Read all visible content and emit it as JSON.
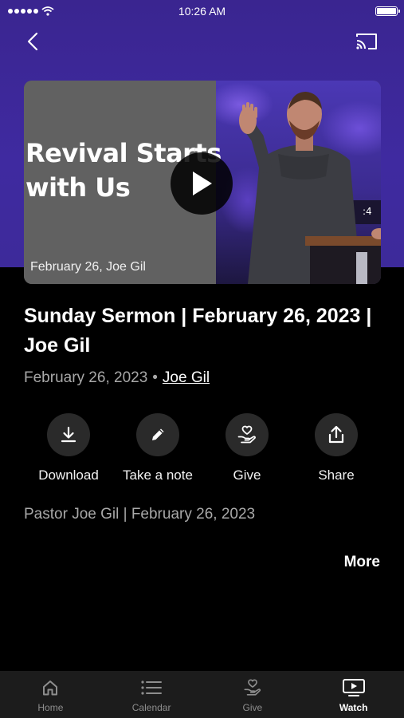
{
  "status_bar": {
    "time": "10:26 AM"
  },
  "video": {
    "title_overlay": "Revival Starts\nwith Us",
    "caption": "February 26, Joe Gil"
  },
  "sermon": {
    "title": "Sunday Sermon | February 26, 2023 | Joe Gil",
    "date": "February 26, 2023",
    "separator": "•",
    "author": "Joe Gil",
    "description": "Pastor Joe Gil | February 26, 2023",
    "more_label": "More"
  },
  "actions": [
    {
      "label": "Download",
      "icon": "download-icon"
    },
    {
      "label": "Take a note",
      "icon": "pencil-icon"
    },
    {
      "label": "Give",
      "icon": "give-hand-heart-icon"
    },
    {
      "label": "Share",
      "icon": "share-icon"
    }
  ],
  "tabs": [
    {
      "label": "Home",
      "icon": "home-icon",
      "active": false
    },
    {
      "label": "Calendar",
      "icon": "calendar-list-icon",
      "active": false
    },
    {
      "label": "Give",
      "icon": "give-hand-heart-icon",
      "active": false
    },
    {
      "label": "Watch",
      "icon": "watch-tv-icon",
      "active": true
    }
  ],
  "colors": {
    "header_purple": "#3f2aa0",
    "background": "#000000",
    "tab_bar": "#1c1c1c",
    "muted_text": "#a8a8a8"
  }
}
